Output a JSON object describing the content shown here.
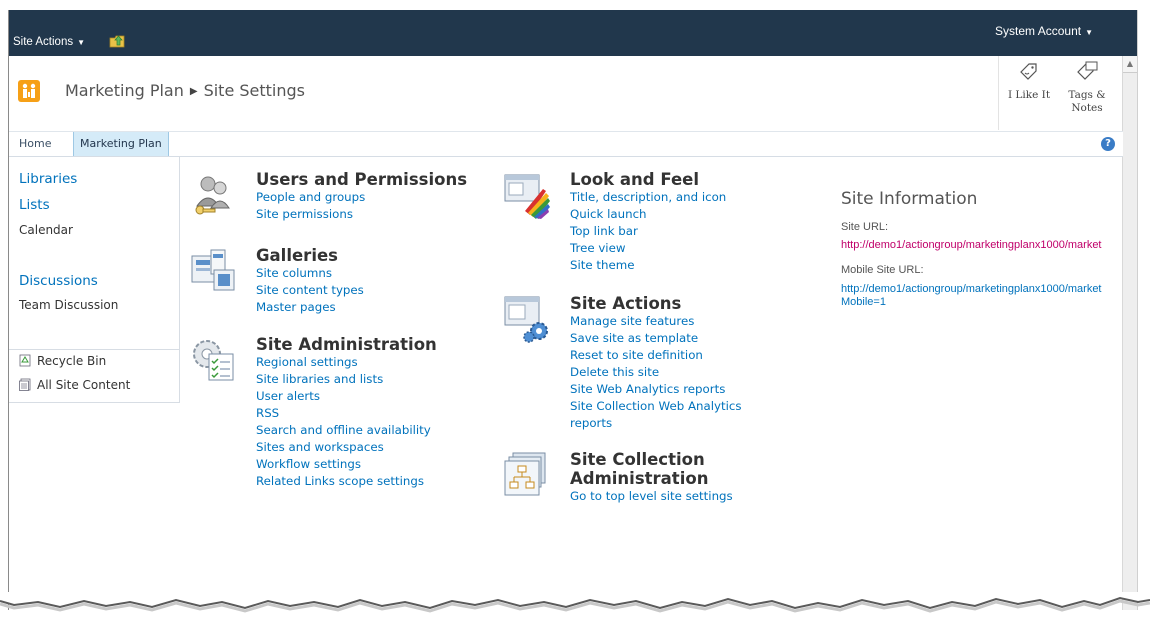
{
  "ribbon": {
    "site_actions_label": "Site Actions",
    "account_label": "System Account"
  },
  "title": {
    "site_name": "Marketing Plan",
    "page_name": "Site Settings",
    "i_like_it": "I Like It",
    "tags_notes": "Tags & Notes"
  },
  "topnav": {
    "home": "Home",
    "marketing_plan": "Marketing Plan"
  },
  "quick_launch": {
    "libraries": "Libraries",
    "lists": "Lists",
    "calendar": "Calendar",
    "discussions": "Discussions",
    "team_discussion": "Team Discussion",
    "recycle_bin": "Recycle Bin",
    "all_site_content": "All Site Content"
  },
  "sections": {
    "users": {
      "title": "Users and Permissions",
      "links": [
        "People and groups",
        "Site permissions"
      ]
    },
    "galleries": {
      "title": "Galleries",
      "links": [
        "Site columns",
        "Site content types",
        "Master pages"
      ]
    },
    "admin": {
      "title": "Site Administration",
      "links": [
        "Regional settings",
        "Site libraries and lists",
        "User alerts",
        "RSS",
        "Search and offline availability",
        "Sites and workspaces",
        "Workflow settings",
        "Related Links scope settings"
      ]
    },
    "look": {
      "title": "Look and Feel",
      "links": [
        "Title, description, and icon",
        "Quick launch",
        "Top link bar",
        "Tree view",
        "Site theme"
      ]
    },
    "actions": {
      "title": "Site Actions",
      "links": [
        "Manage site features",
        "Save site as template",
        "Reset to site definition",
        "Delete this site",
        "Site Web Analytics reports",
        "Site Collection Web Analytics",
        "reports"
      ]
    },
    "collection": {
      "title_line1": "Site Collection",
      "title_line2": "Administration",
      "links": [
        "Go to top level site settings"
      ]
    }
  },
  "site_info": {
    "title": "Site Information",
    "site_url_label": "Site URL:",
    "site_url": "http://demo1/actiongroup/marketingplanx1000/market",
    "mobile_url_label": "Mobile Site URL:",
    "mobile_url_line1": "http://demo1/actiongroup/marketingplanx1000/market",
    "mobile_url_line2": "Mobile=1"
  },
  "colors": {
    "ribbon": "#21374c",
    "link": "#0072bc",
    "visited_link": "#c0006a",
    "nav_selected": "#d5ebf8"
  }
}
